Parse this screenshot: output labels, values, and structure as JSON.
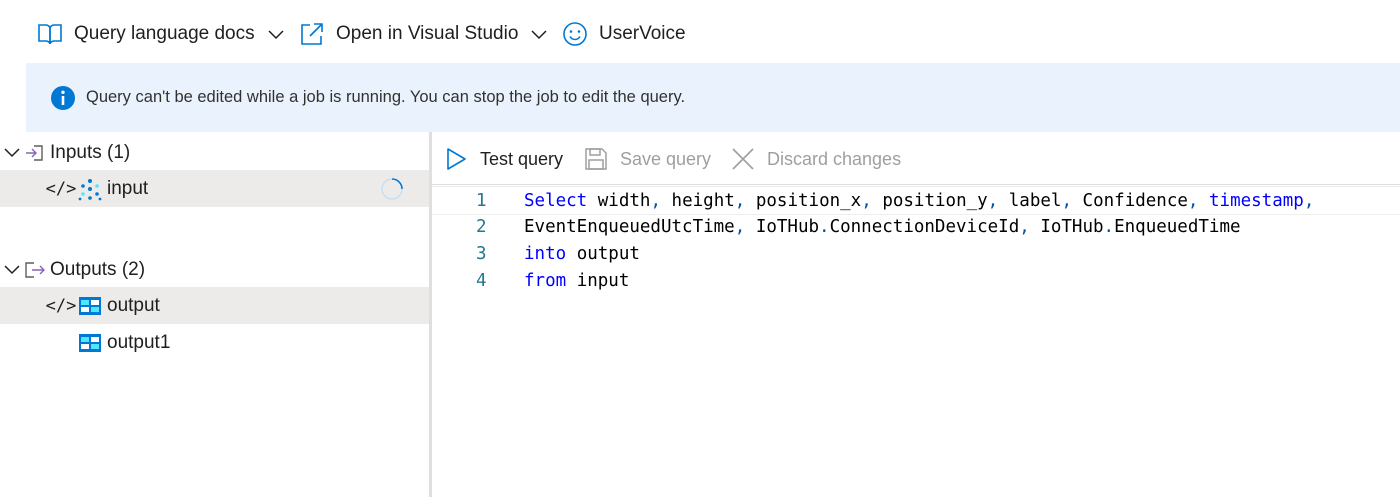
{
  "toolbar": {
    "docs_label": "Query language docs",
    "vs_label": "Open in Visual Studio",
    "uservoice_label": "UserVoice"
  },
  "banner": {
    "message": "Query can't be edited while a job is running. You can stop the job to edit the query."
  },
  "tree": {
    "inputs": {
      "label": "Inputs (1)",
      "items": [
        {
          "label": "input"
        }
      ]
    },
    "outputs": {
      "label": "Outputs (2)",
      "items": [
        {
          "label": "output"
        },
        {
          "label": "output1"
        }
      ]
    }
  },
  "query_toolbar": {
    "test_label": "Test query",
    "save_label": "Save query",
    "discard_label": "Discard changes"
  },
  "editor": {
    "lines": [
      {
        "number": "1",
        "text": "Select width, height, position_x, position_y, label, Confidence, timestamp,"
      },
      {
        "number": "2",
        "text": "EventEnqueuedUtcTime, IoTHub.ConnectionDeviceId, IoTHub.EnqueuedTime"
      },
      {
        "number": "3",
        "text": "into output"
      },
      {
        "number": "4",
        "text": "from input"
      }
    ]
  },
  "colors": {
    "accent": "#0078d4",
    "banner_bg": "#eaf3fd",
    "selected_row": "#edebe9",
    "keyword": "#0000ff"
  }
}
